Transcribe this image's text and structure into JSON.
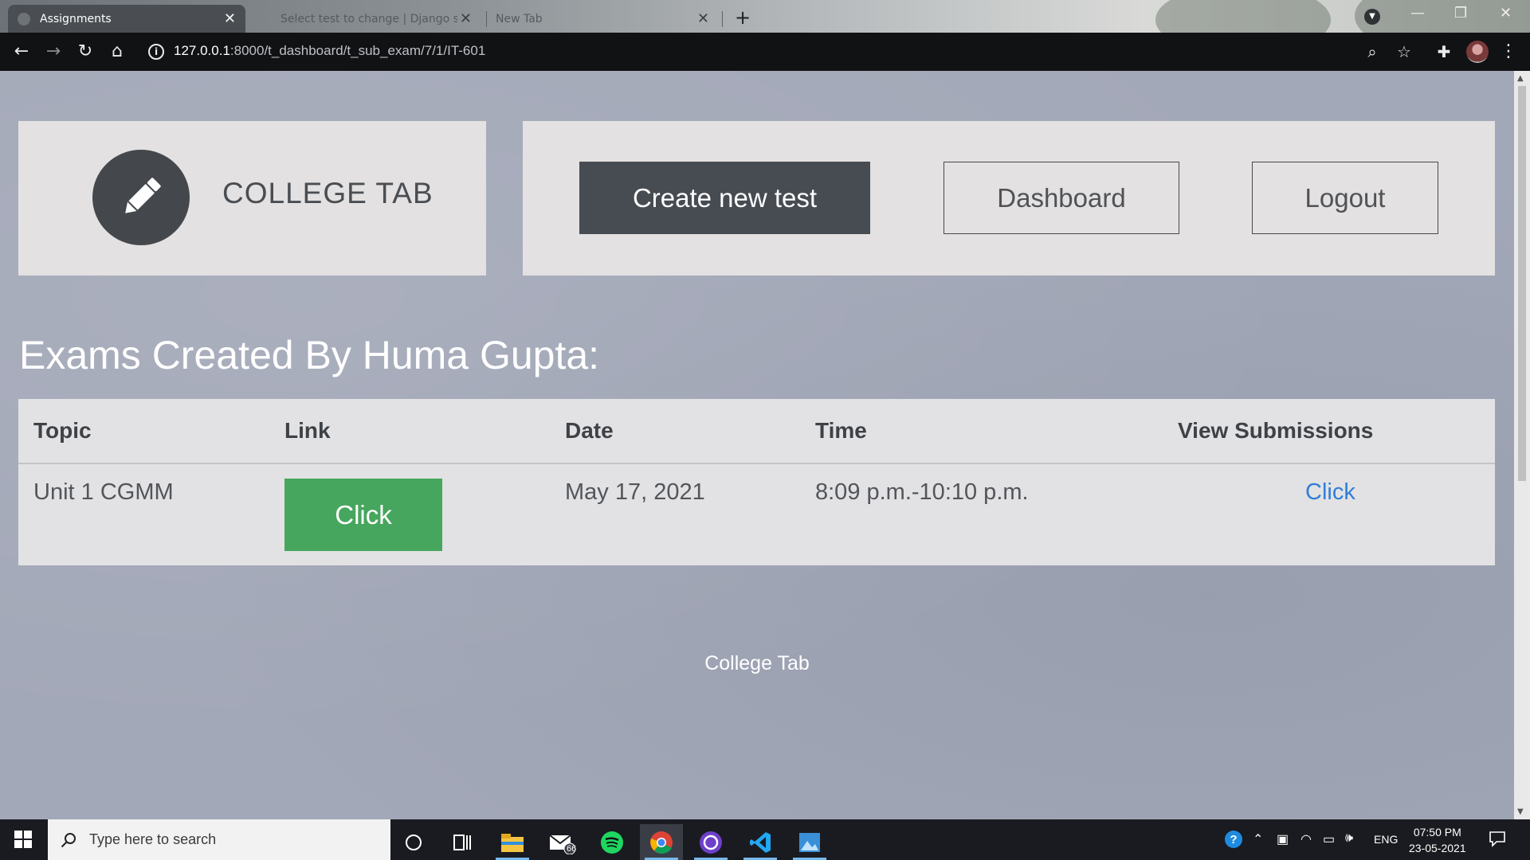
{
  "browser": {
    "tabs": [
      {
        "title": "Assignments",
        "active": true
      },
      {
        "title": "Select test to change | Django si",
        "active": false
      },
      {
        "title": "New Tab",
        "active": false
      }
    ],
    "url_host": "127.0.0.1",
    "url_path": ":8000/t_dashboard/t_sub_exam/7/1/IT-601"
  },
  "header": {
    "brand_name": "COLLEGE TAB",
    "logo_icon": "pencil-icon",
    "nav": {
      "create": "Create new test",
      "dashboard": "Dashboard",
      "logout": "Logout"
    }
  },
  "main": {
    "heading": "Exams Created By Huma Gupta:",
    "table": {
      "columns": [
        "Topic",
        "Link",
        "Date",
        "Time",
        "View Submissions"
      ],
      "rows": [
        {
          "topic": "Unit 1 CGMM",
          "link_label": "Click",
          "date": "May 17, 2021",
          "time": "8:09 p.m.-10:10 p.m.",
          "view_label": "Click"
        }
      ]
    }
  },
  "footer": {
    "text": "College Tab"
  },
  "taskbar": {
    "search_placeholder": "Type here to search",
    "mail_badge": "66",
    "language": "ENG",
    "time": "07:50 PM",
    "date": "23-05-2021"
  },
  "colors": {
    "page_bg": "#a3a8b8",
    "panel_bg": "#e3e1e1",
    "dark_button": "#474b52",
    "green_button": "#47a65d",
    "link_blue": "#2f7ed8"
  }
}
